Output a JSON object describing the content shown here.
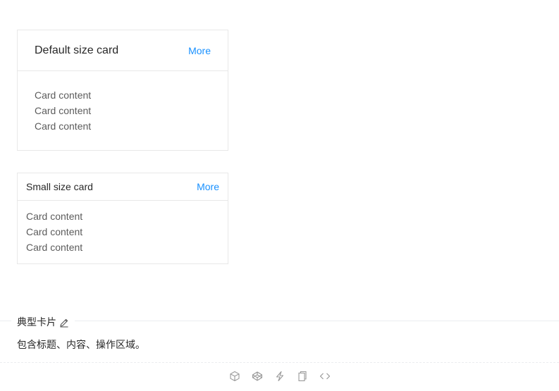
{
  "cards": {
    "default": {
      "title": "Default size card",
      "extra": "More",
      "content": [
        "Card content",
        "Card content",
        "Card content"
      ]
    },
    "small": {
      "title": "Small size card",
      "extra": "More",
      "content": [
        "Card content",
        "Card content",
        "Card content"
      ]
    }
  },
  "demo": {
    "title": "典型卡片",
    "description": "包含标题、内容、操作区域。"
  },
  "actions": [
    "codesandbox-icon",
    "codepen-icon",
    "riddle-icon",
    "copy-icon",
    "code-expand-icon"
  ],
  "colors": {
    "accent": "#1890ff",
    "border": "#e8e8e8",
    "icon": "#999999"
  }
}
